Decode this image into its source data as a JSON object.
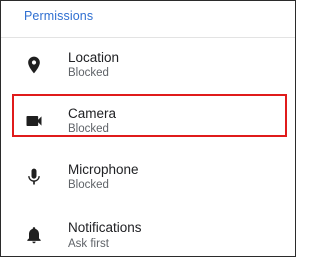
{
  "permissions": {
    "title": "Permissions",
    "items": [
      {
        "icon": "location-pin-icon",
        "label": "Location",
        "status": "Blocked"
      },
      {
        "icon": "videocam-icon",
        "label": "Camera",
        "status": "Blocked"
      },
      {
        "icon": "microphone-icon",
        "label": "Microphone",
        "status": "Blocked"
      },
      {
        "icon": "bell-icon",
        "label": "Notifications",
        "status": "Ask first"
      }
    ]
  },
  "colors": {
    "section_title": "#2f6fd1",
    "highlight_border": "#e01b1b",
    "icon": "#1f1f1f",
    "primary_text": "#202124",
    "secondary_text": "#5f6368"
  }
}
